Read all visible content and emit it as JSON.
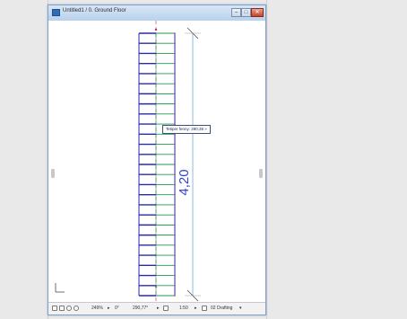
{
  "window": {
    "title": "Untitled1 / 0. Ground Floor",
    "minimize_icon": "minimize-icon",
    "maximize_icon": "maximize-icon",
    "close_icon": "close-icon"
  },
  "drawing": {
    "dimension_label": "4,20",
    "tooltip_label": "Tetiper fenny: 280,38",
    "tooltip_arrow": "»",
    "stair_treads": 26,
    "colors": {
      "stair_blue": "#2a2aa8",
      "stair_green": "#1f9a4a",
      "stair_magenta": "#c0287a",
      "dimension_blue": "#2f45c8",
      "dimension_line": "#7fb7d8",
      "axis_magenta": "#d04090"
    }
  },
  "status": {
    "zoom": "249%",
    "angle": "0°",
    "angle2": "290,77°",
    "scale": "1:50",
    "layer": "02 Drafting",
    "icons": [
      "undo-icon",
      "redo-icon",
      "zoom-in-icon",
      "zoom-out-icon"
    ]
  }
}
